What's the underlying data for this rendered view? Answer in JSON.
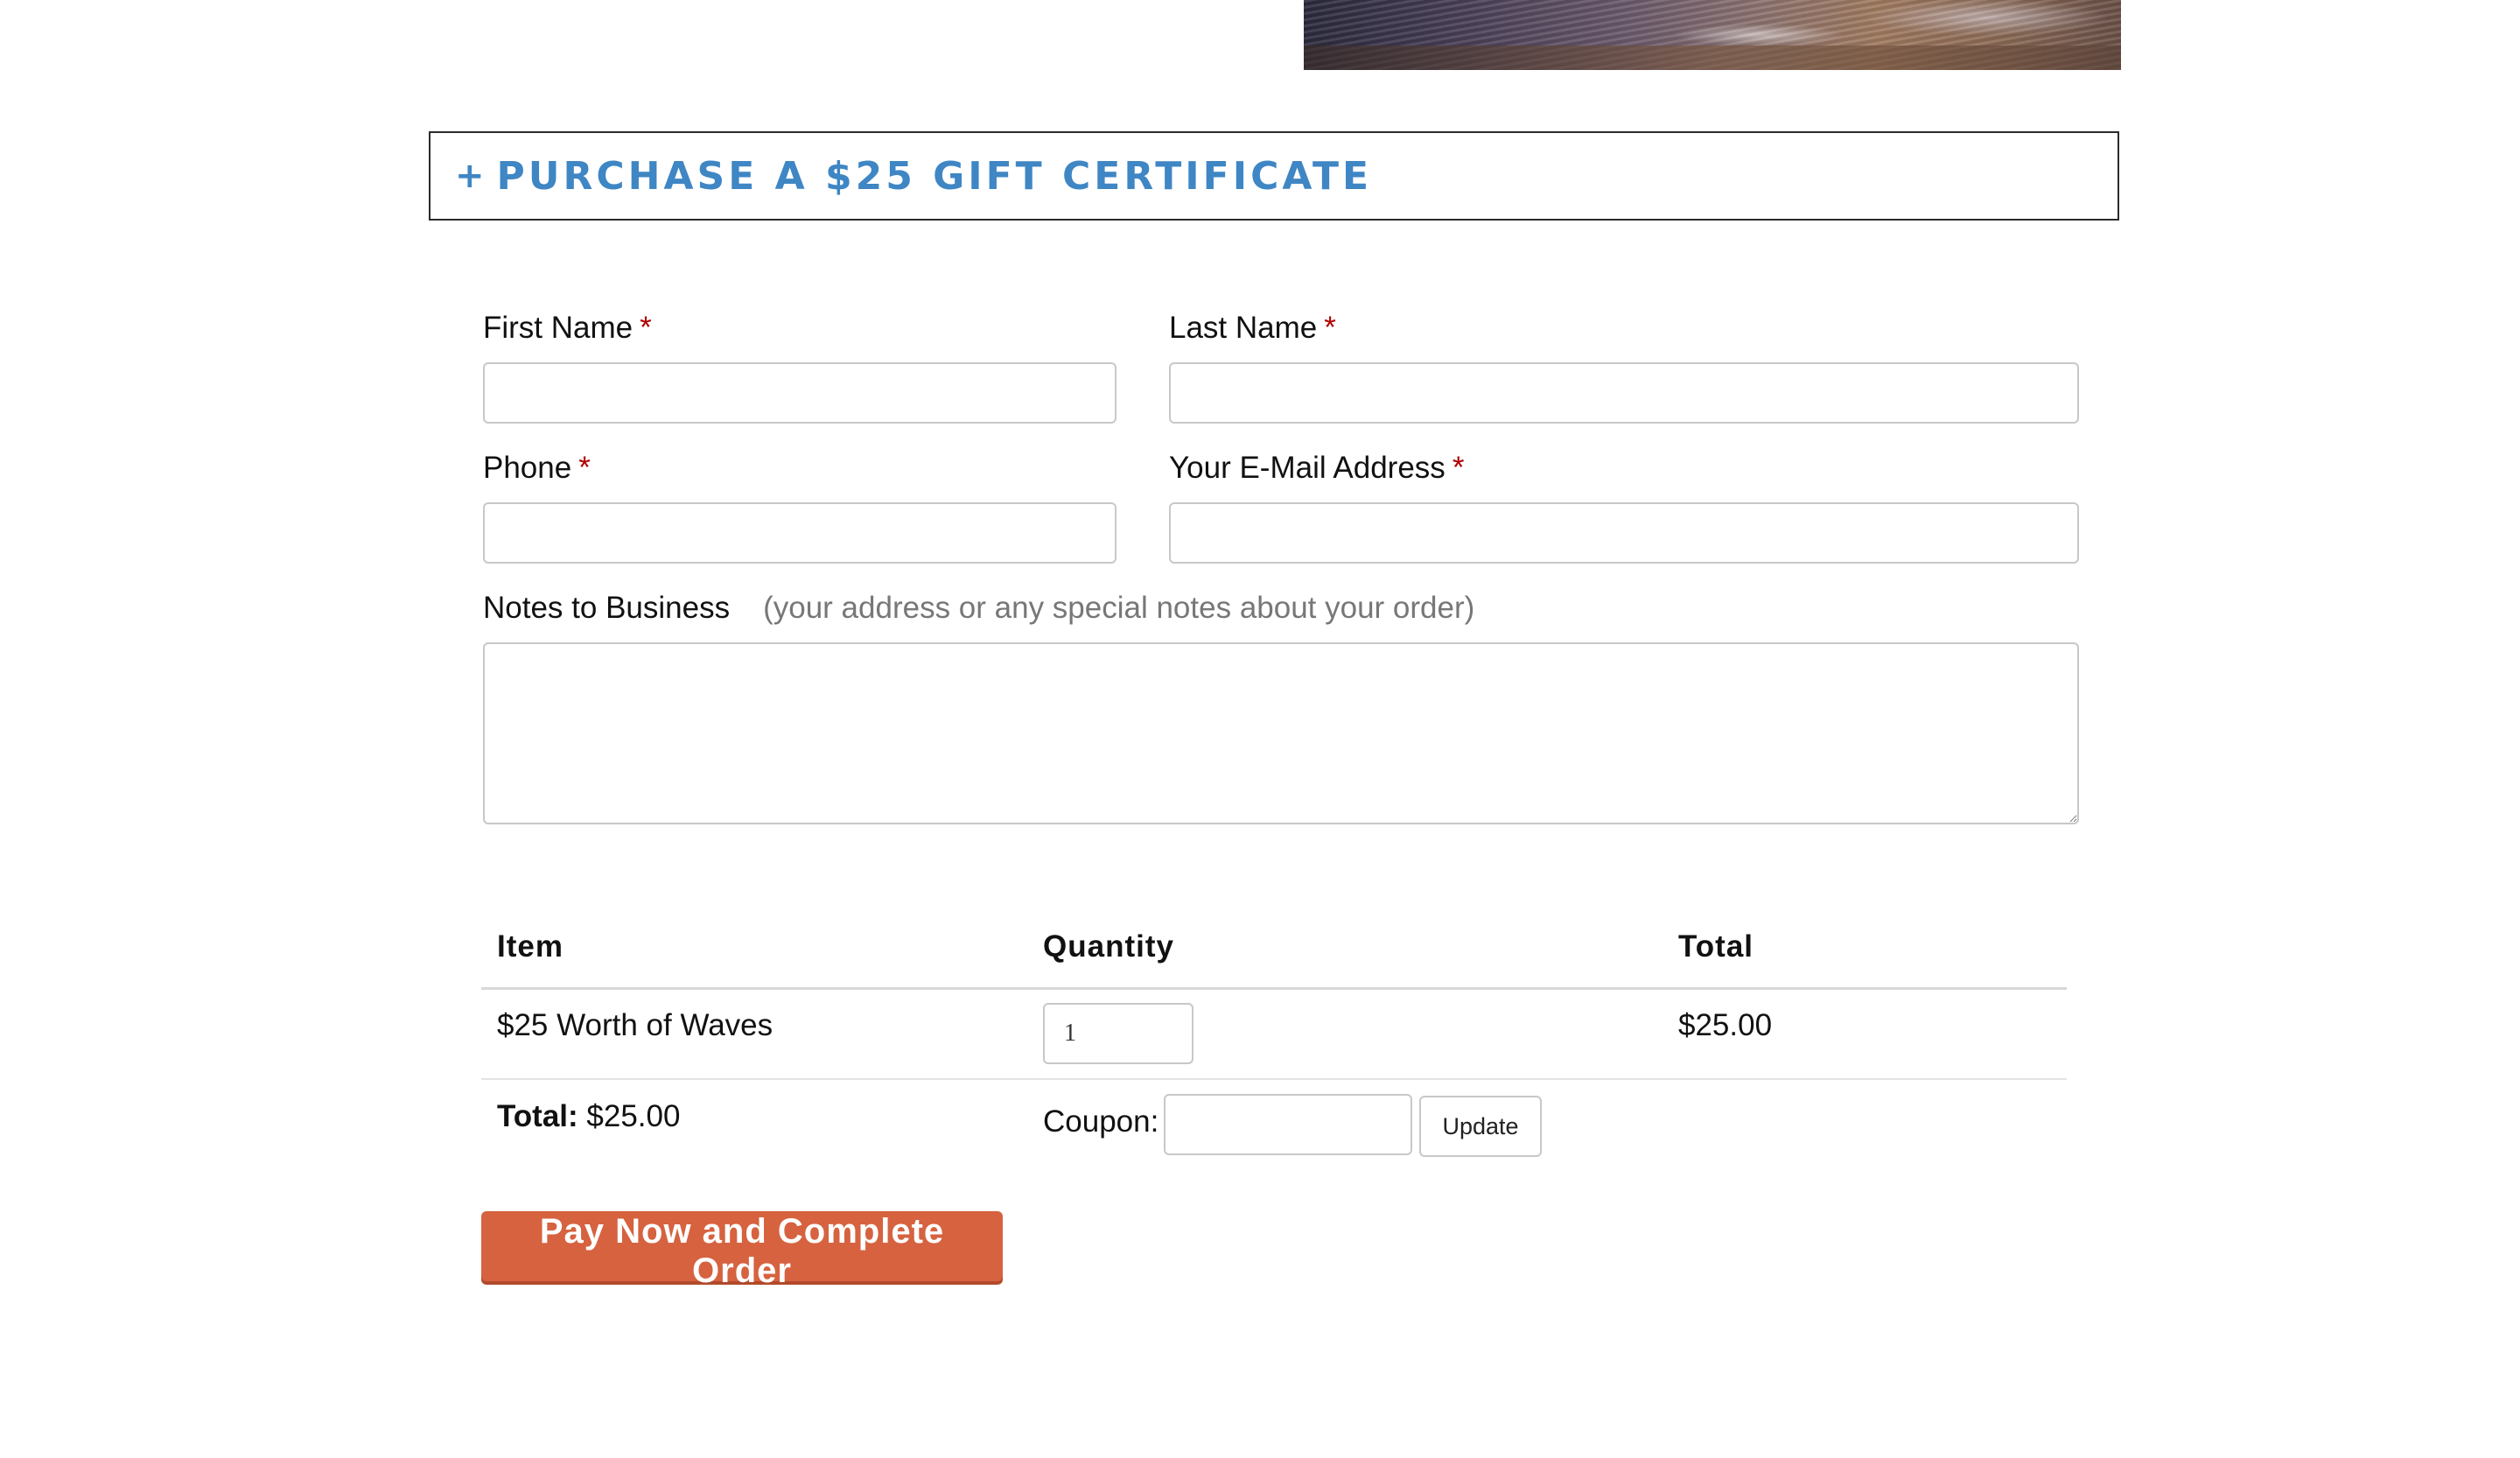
{
  "accordion": {
    "icon": "plus-icon",
    "plus_symbol": "+",
    "title": "PURCHASE A $25 GIFT CERTIFICATE",
    "color": "#3f86c4"
  },
  "form": {
    "first_name": {
      "label": "First Name",
      "required_mark": "*",
      "value": ""
    },
    "last_name": {
      "label": "Last Name",
      "required_mark": "*",
      "value": ""
    },
    "phone": {
      "label": "Phone",
      "required_mark": "*",
      "value": ""
    },
    "email": {
      "label": "Your E-Mail Address",
      "required_mark": "*",
      "value": ""
    },
    "notes": {
      "label": "Notes to Business",
      "hint": "(your address or any special notes about your order)",
      "value": ""
    }
  },
  "order": {
    "headers": {
      "item": "Item",
      "quantity": "Quantity",
      "total": "Total"
    },
    "rows": [
      {
        "item": "$25 Worth of Waves",
        "quantity": "1",
        "total": "$25.00"
      }
    ],
    "summary": {
      "total_label": "Total:",
      "total_value": "$25.00",
      "coupon_label": "Coupon:",
      "coupon_value": "",
      "update_label": "Update"
    }
  },
  "pay_button": {
    "label": "Pay Now and Complete Order",
    "color": "#d6623f"
  }
}
